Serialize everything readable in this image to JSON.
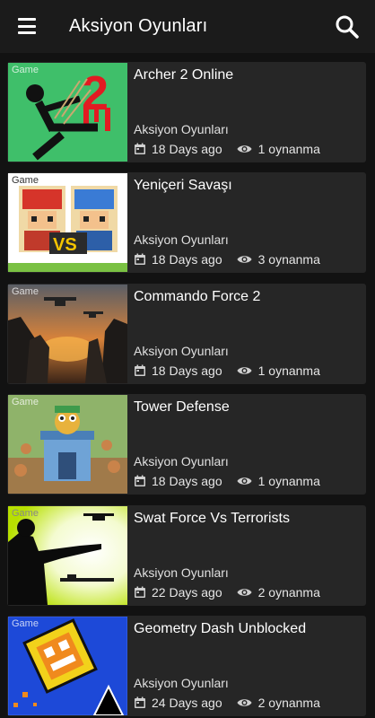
{
  "appbar": {
    "title": "Aksiyon Oyunları"
  },
  "icons": {
    "menu": "menu-icon",
    "search": "search-icon",
    "date": "calendar-icon",
    "views": "eye-icon"
  },
  "games": [
    {
      "badge": "Game",
      "title": "Archer 2 Online",
      "category": "Aksiyon Oyunları",
      "date": "18 Days ago",
      "plays": "1 oynanma"
    },
    {
      "badge": "Game",
      "title": "Yeniçeri Savaşı",
      "category": "Aksiyon Oyunları",
      "date": "18 Days ago",
      "plays": "3 oynanma"
    },
    {
      "badge": "Game",
      "title": "Commando Force 2",
      "category": "Aksiyon Oyunları",
      "date": "18 Days ago",
      "plays": "1 oynanma"
    },
    {
      "badge": "Game",
      "title": "Tower Defense",
      "category": "Aksiyon Oyunları",
      "date": "18 Days ago",
      "plays": "1 oynanma"
    },
    {
      "badge": "Game",
      "title": "Swat Force Vs Terrorists",
      "category": "Aksiyon Oyunları",
      "date": "22 Days ago",
      "plays": "2 oynanma"
    },
    {
      "badge": "Game",
      "title": "Geometry Dash Unblocked",
      "category": "Aksiyon Oyunları",
      "date": "24 Days ago",
      "plays": "2 oynanma"
    }
  ],
  "colors": {
    "background": "#121212",
    "appbar": "#1b1b1b",
    "card": "#262626"
  }
}
